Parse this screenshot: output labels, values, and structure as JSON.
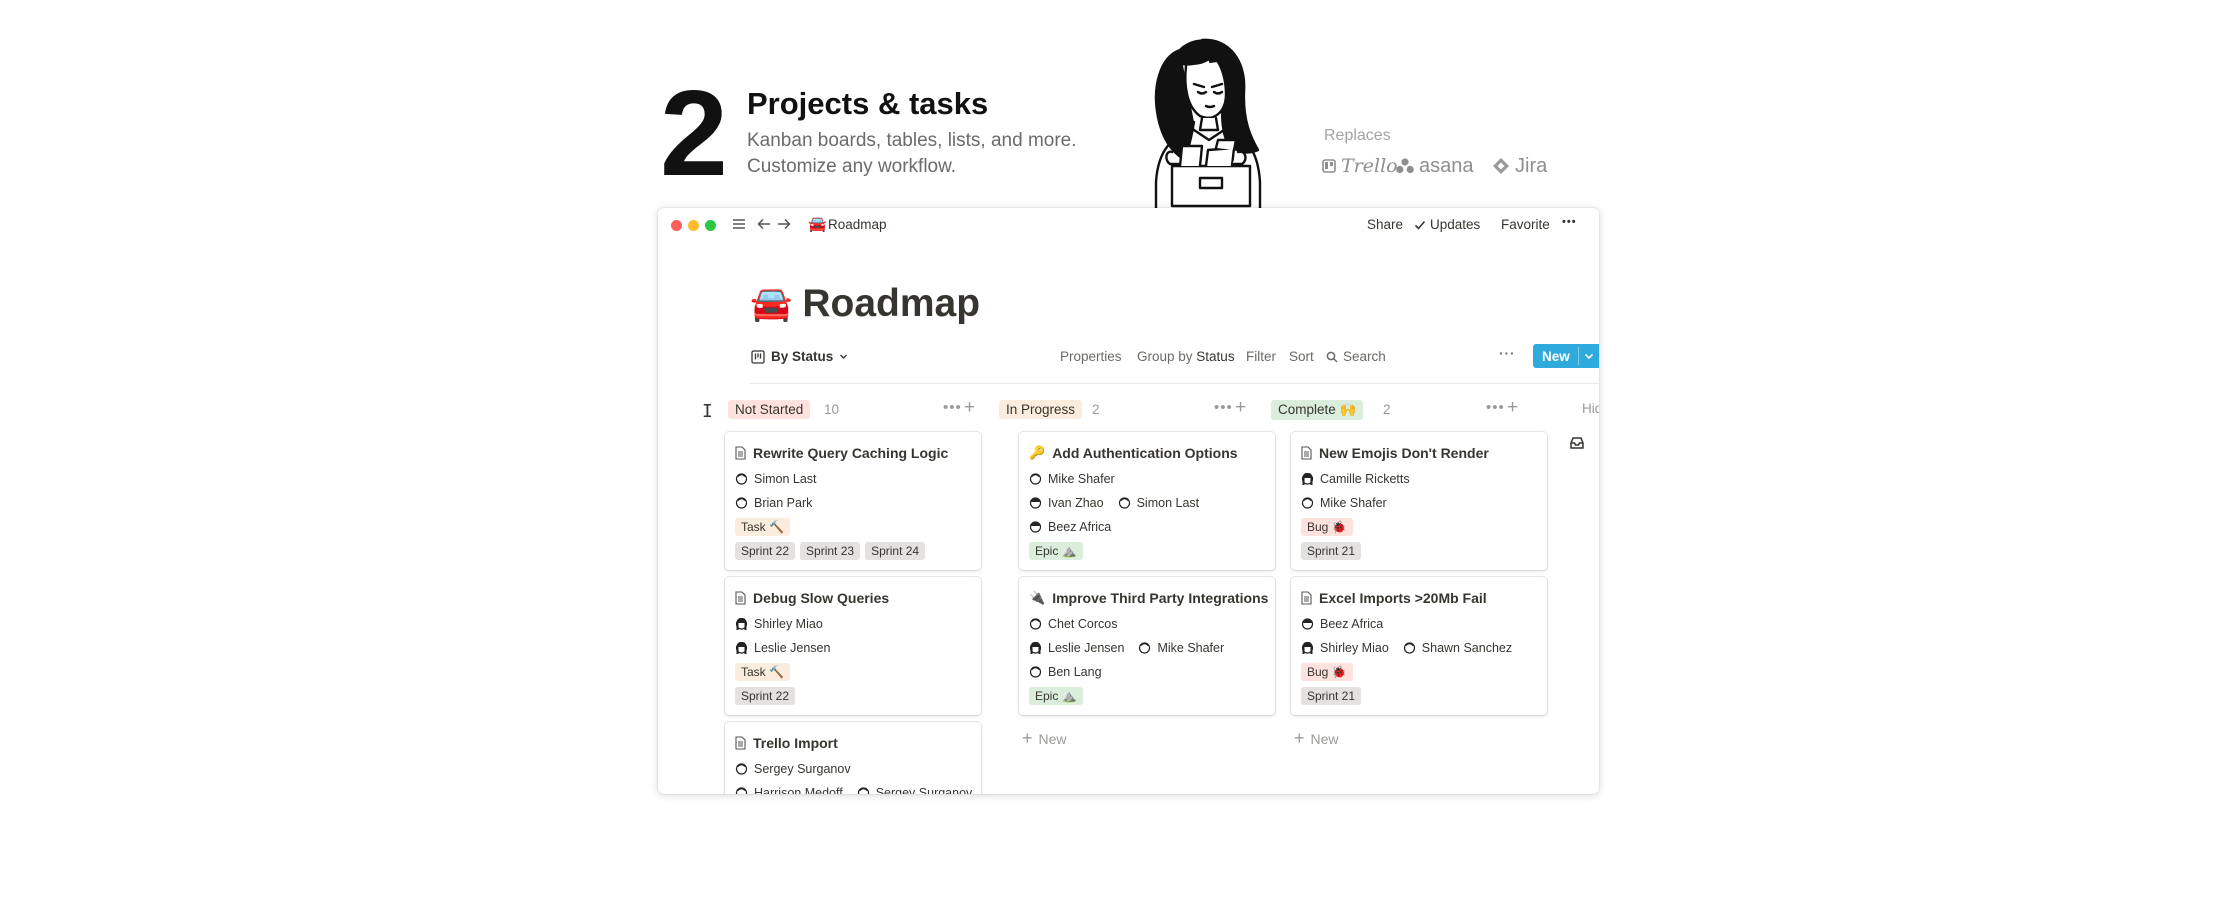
{
  "hero": {
    "number": "2",
    "title": "Projects & tasks",
    "desc_line1": "Kanban boards, tables, lists, and more.",
    "desc_line2": "Customize any workflow.",
    "replaces_label": "Replaces",
    "brands": [
      "Trello",
      "asana",
      "Jira"
    ]
  },
  "window": {
    "breadcrumb_emoji": "🚘",
    "breadcrumb": "Roadmap",
    "share": "Share",
    "updates": "Updates",
    "favorite": "Favorite",
    "more": "•••"
  },
  "page": {
    "emoji": "🚘",
    "title": "Roadmap"
  },
  "view_toolbar": {
    "view_name": "By Status",
    "properties": "Properties",
    "group_by_prefix": "Group by",
    "group_by_value": "Status",
    "filter": "Filter",
    "sort": "Sort",
    "search": "Search",
    "more": "···",
    "new_label": "New"
  },
  "columns": [
    {
      "status": "Not Started",
      "count": "10",
      "color": "#ffe2dd",
      "cards": [
        {
          "title": "Rewrite Query Caching Logic",
          "people": [
            [
              "Simon Last"
            ],
            [
              "Brian Park"
            ]
          ],
          "type": "Task 🔨",
          "type_class": "task",
          "sprints": [
            "Sprint 22",
            "Sprint 23",
            "Sprint 24"
          ]
        },
        {
          "title": "Debug Slow Queries",
          "people": [
            [
              "Shirley Miao"
            ],
            [
              "Leslie Jensen"
            ]
          ],
          "type": "Task 🔨",
          "type_class": "task",
          "sprints": [
            "Sprint 22"
          ]
        },
        {
          "title": "Trello Import",
          "people": [
            [
              "Sergey Surganov"
            ],
            [
              "Harrison Medoff",
              "Sergey Surganov"
            ]
          ],
          "type": "",
          "type_class": "",
          "sprints": []
        }
      ]
    },
    {
      "status": "In Progress",
      "count": "2",
      "color": "#fbecdd",
      "new_label": "New",
      "cards": [
        {
          "title": "Add Authentication Options",
          "icon": "🔑",
          "people": [
            [
              "Mike Shafer"
            ],
            [
              "Ivan Zhao",
              "Simon Last"
            ],
            [
              "Beez Africa"
            ]
          ],
          "type": "Epic ⛰️",
          "type_class": "epic",
          "sprints": []
        },
        {
          "title": "Improve Third Party Integrations",
          "icon": "🔌",
          "people": [
            [
              "Chet Corcos"
            ],
            [
              "Leslie Jensen",
              "Mike Shafer"
            ],
            [
              "Ben Lang"
            ]
          ],
          "type": "Epic ⛰️",
          "type_class": "epic",
          "sprints": []
        }
      ]
    },
    {
      "status": "Complete 🙌",
      "count": "2",
      "color": "#dbeddb",
      "new_label": "New",
      "cards": [
        {
          "title": "New Emojis Don't Render",
          "people": [
            [
              "Camille Ricketts"
            ],
            [
              "Mike Shafer"
            ]
          ],
          "type": "Bug 🐞",
          "type_class": "bug",
          "sprints": [
            "Sprint 21"
          ]
        },
        {
          "title": "Excel Imports >20Mb Fail",
          "people": [
            [
              "Beez Africa"
            ],
            [
              "Shirley Miao",
              "Shawn Sanchez"
            ]
          ],
          "type": "Bug 🐞",
          "type_class": "bug",
          "sprints": [
            "Sprint 21"
          ]
        }
      ]
    }
  ],
  "hidden_column_label": "Hidd"
}
